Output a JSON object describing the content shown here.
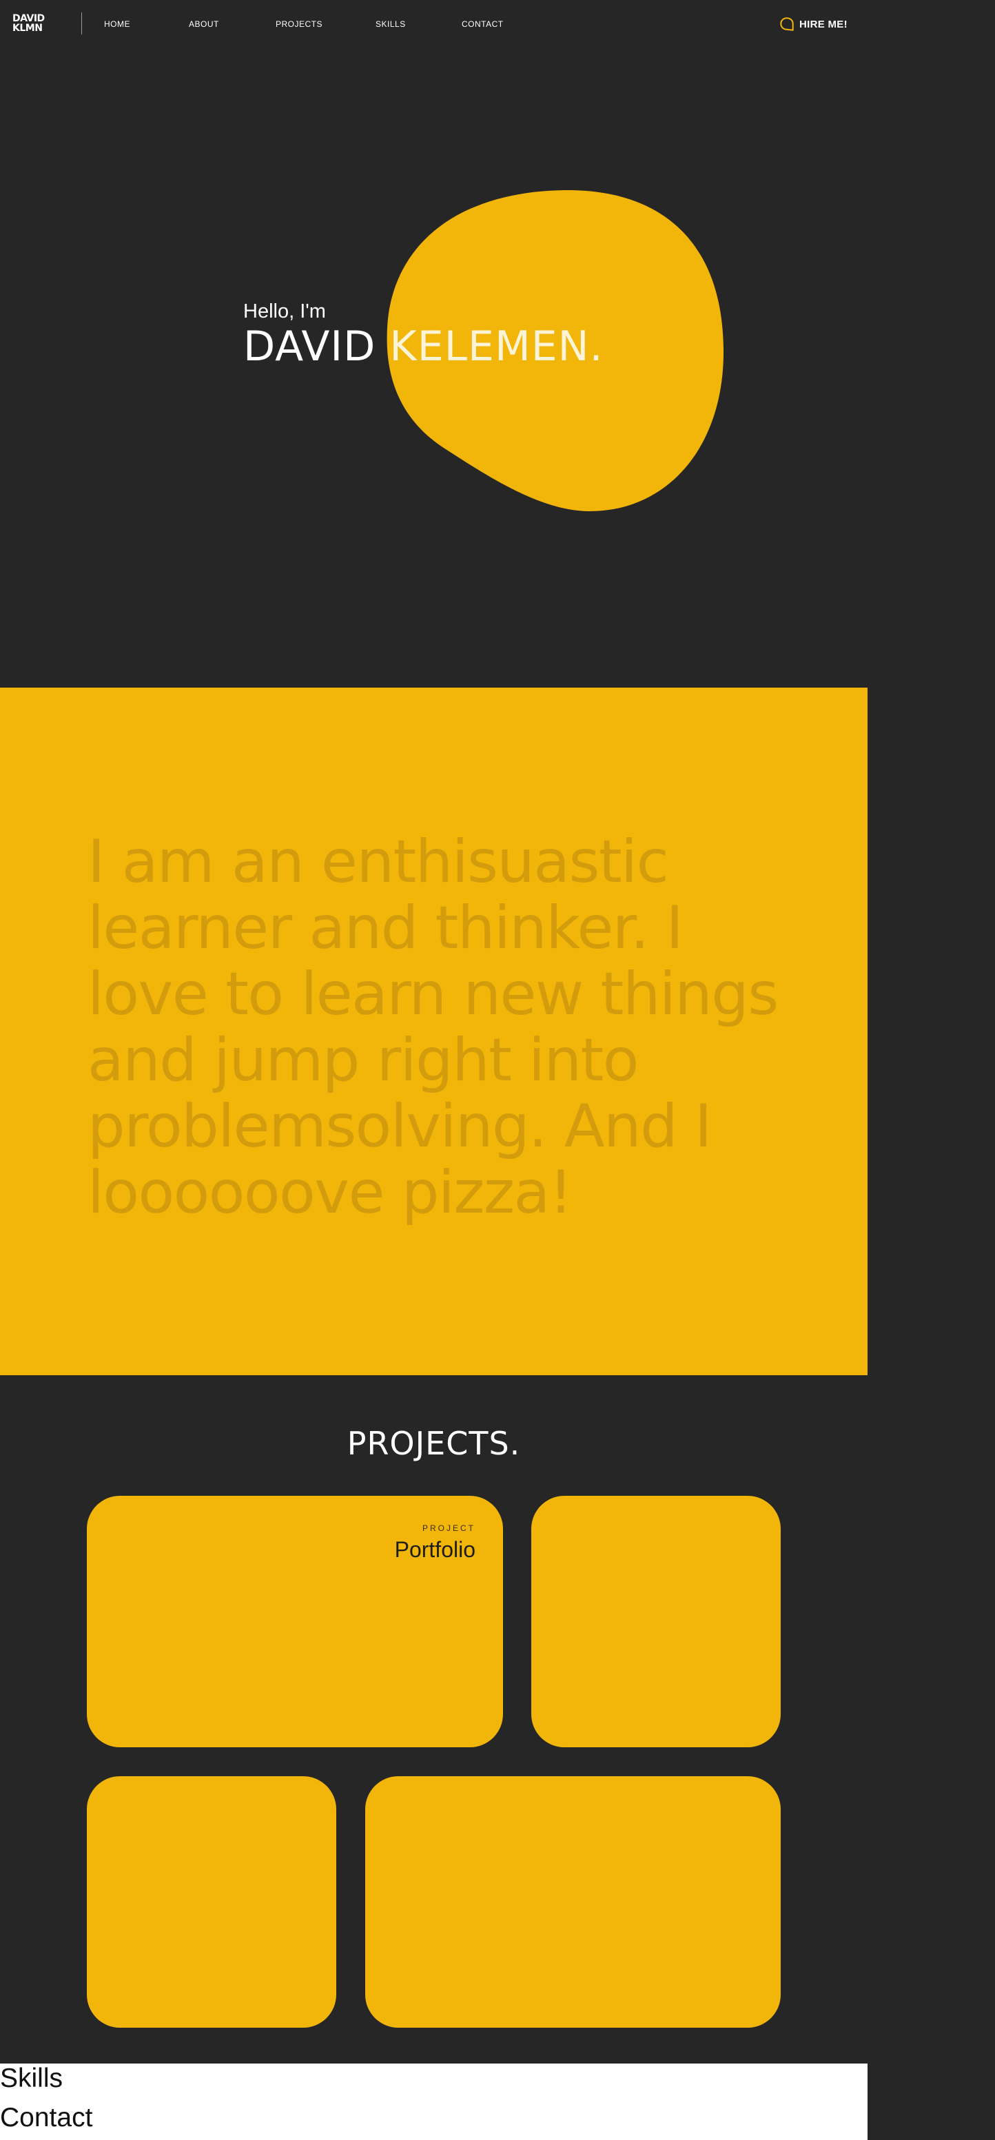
{
  "nav": {
    "logo_line1": "DAVID",
    "logo_line2": "KLMN",
    "links": [
      {
        "label": "HOME"
      },
      {
        "label": "ABOUT"
      },
      {
        "label": "PROJECTS"
      },
      {
        "label": "SKILLS"
      },
      {
        "label": "CONTACT"
      }
    ],
    "hire_label": "HIRE ME!",
    "hire_icon": "chat-bubble-icon"
  },
  "hero": {
    "greeting": "Hello, I'm",
    "first_name": "DAVID",
    "last_name": "KELEMEN."
  },
  "about": {
    "text": "I am an enthisuastic learner and thinker. I love to learn new things and jump right into problemsolving. And I loooooove pizza!"
  },
  "projects": {
    "title": "PROJECTS.",
    "cards": [
      {
        "kicker": "PROJECT",
        "title": "Portfolio"
      },
      {
        "kicker": "",
        "title": ""
      },
      {
        "kicker": "",
        "title": ""
      },
      {
        "kicker": "",
        "title": ""
      }
    ]
  },
  "footer": {
    "skills_label": "Skills",
    "contact_label": "Contact"
  },
  "colors": {
    "background": "#262626",
    "accent": "#f2b50a",
    "about_text": "#d29c0d",
    "footer_background": "#ffffff"
  }
}
